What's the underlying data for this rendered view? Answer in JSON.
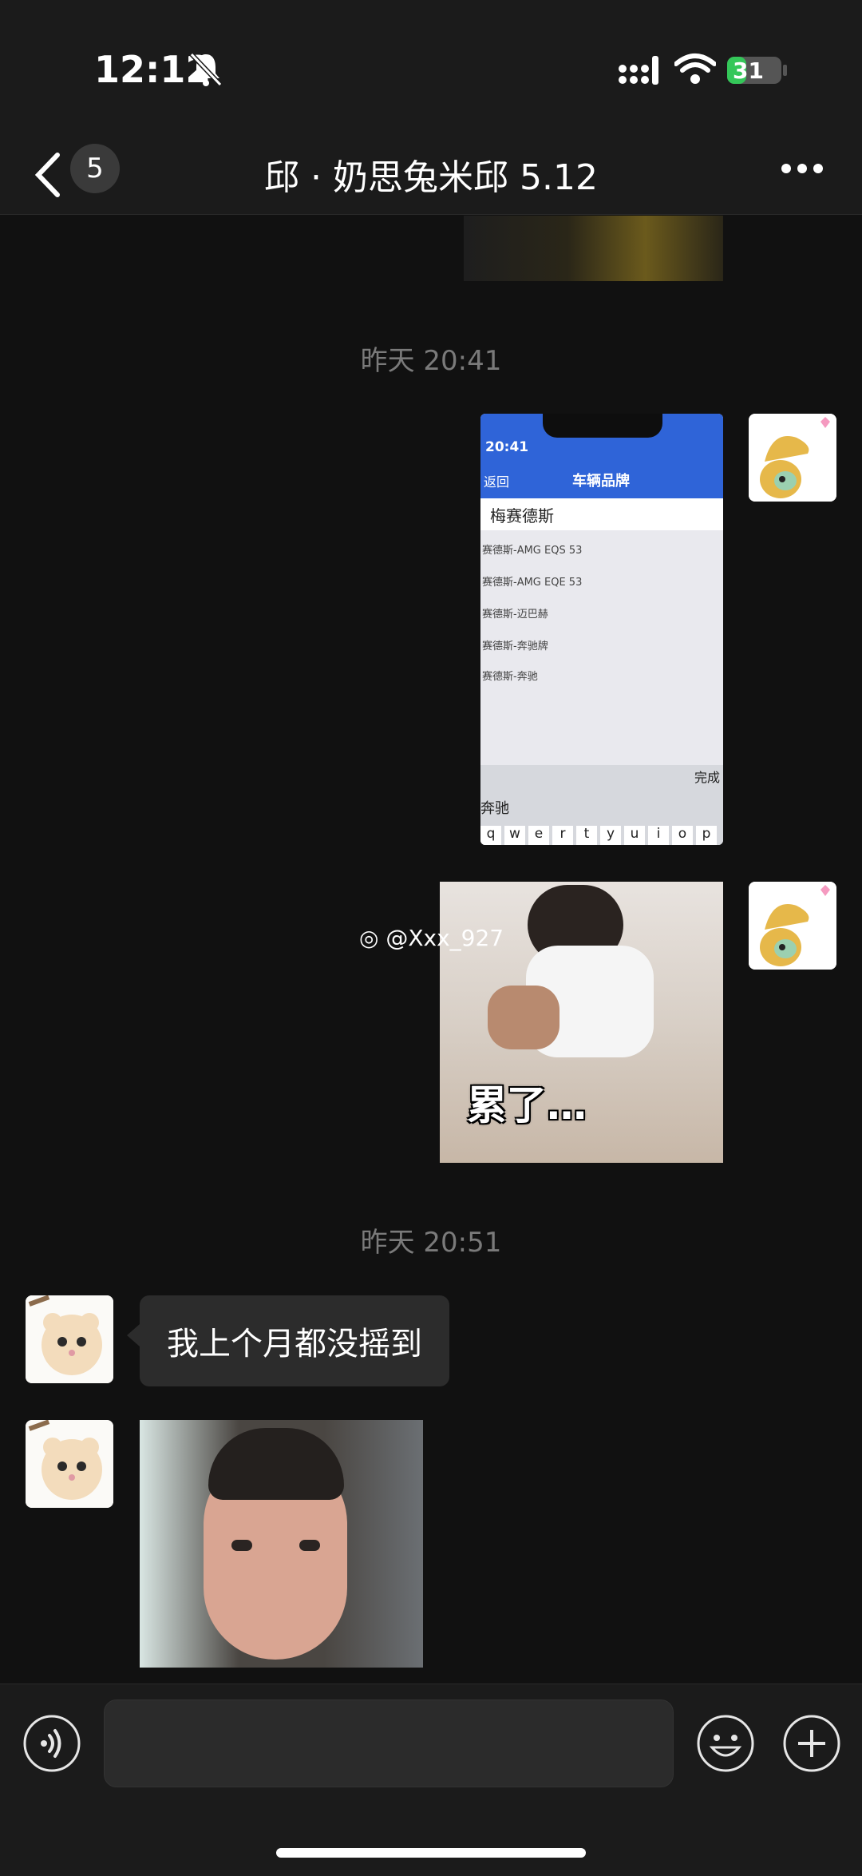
{
  "status_bar": {
    "time": "12:12",
    "battery": "31"
  },
  "nav": {
    "unread_count": "5",
    "title": "邱 · 奶思兔米邱 5.12"
  },
  "chat": {
    "timestamp_1": "昨天 20:41",
    "screenshot_message": {
      "time": "20:41",
      "back": "返回",
      "header": "车辆品牌",
      "search": "梅赛德斯",
      "results": [
        "赛德斯-AMG EQS 53",
        "赛德斯-AMG EQE 53",
        "赛德斯-迈巴赫",
        "赛德斯-奔驰牌",
        "赛德斯-奔驰"
      ],
      "done": "完成",
      "candidate": "奔驰",
      "keys": [
        "q",
        "w",
        "e",
        "r",
        "t",
        "y",
        "u",
        "i",
        "o",
        "p"
      ]
    },
    "meme_caption": "累了…",
    "watermark": "@Xxx_927",
    "timestamp_2": "昨天 20:51",
    "incoming_text": "我上个月都没摇到"
  },
  "icons": {
    "back": "chevron-left-icon",
    "more": "more-dots-icon",
    "voice": "voice-icon",
    "emoji": "emoji-icon",
    "plus": "plus-icon"
  }
}
